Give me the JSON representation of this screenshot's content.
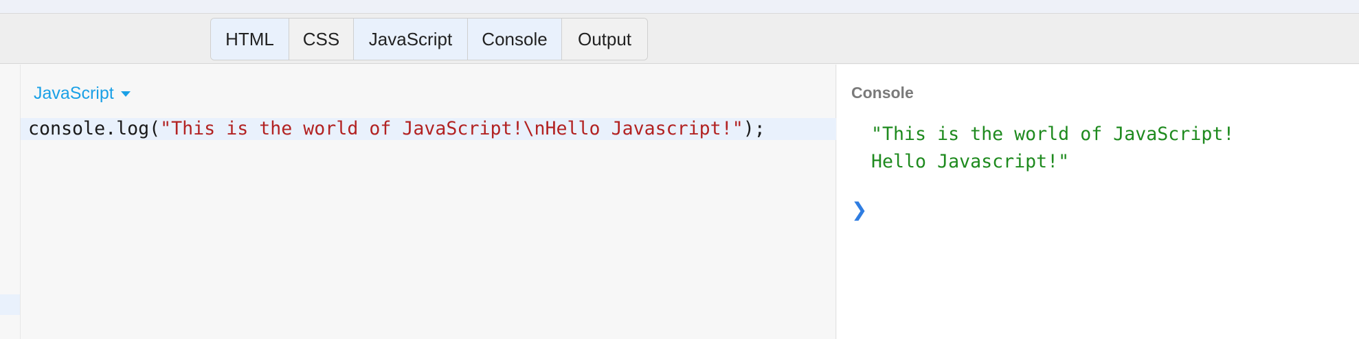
{
  "tabs": [
    {
      "label": "HTML",
      "active": true
    },
    {
      "label": "CSS",
      "active": false
    },
    {
      "label": "JavaScript",
      "active": true
    },
    {
      "label": "Console",
      "active": true
    },
    {
      "label": "Output",
      "active": false
    }
  ],
  "editor": {
    "language_label": "JavaScript",
    "code": {
      "prefix": "console.log(",
      "string": "\"This is the world of JavaScript!\\nHello Javascript!\"",
      "suffix": ");"
    }
  },
  "console": {
    "title": "Console",
    "output_line1": "\"This is the world of JavaScript!",
    "output_line2": "Hello Javascript!\"",
    "prompt": "❯"
  },
  "colors": {
    "accent": "#1aa0e6",
    "code_string": "#b22222",
    "console_output": "#1e8a1e",
    "prompt": "#2f7de1"
  }
}
